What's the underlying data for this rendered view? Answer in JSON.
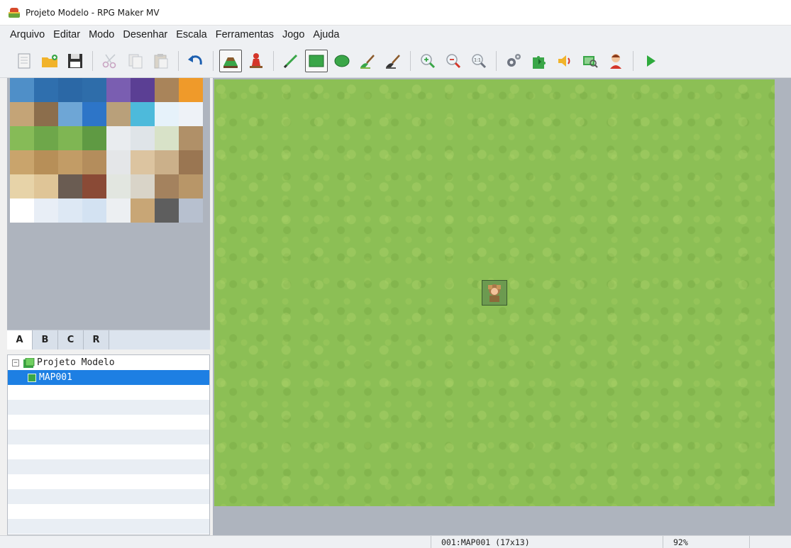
{
  "window": {
    "title": "Projeto Modelo - RPG Maker MV"
  },
  "menu": [
    "Arquivo",
    "Editar",
    "Modo",
    "Desenhar",
    "Escala",
    "Ferramentas",
    "Jogo",
    "Ajuda"
  ],
  "toolbar": {
    "groups": [
      [
        "new-project-icon",
        "open-project-icon",
        "save-project-icon"
      ],
      [
        "cut-icon",
        "copy-icon",
        "paste-icon"
      ],
      [
        "undo-icon"
      ],
      [
        "map-mode-icon",
        "event-mode-icon"
      ],
      [
        "pencil-icon",
        "rectangle-icon",
        "ellipse-icon",
        "fill-icon",
        "shadow-pen-icon"
      ],
      [
        "zoom-in-icon",
        "zoom-out-icon",
        "zoom-actual-icon"
      ],
      [
        "database-icon",
        "plugin-manager-icon",
        "sound-test-icon",
        "event-searcher-icon",
        "character-generator-icon"
      ],
      [
        "playtest-icon"
      ]
    ],
    "active": [
      "map-mode-icon",
      "rectangle-icon"
    ]
  },
  "tileset_tabs": [
    "A",
    "B",
    "C",
    "R"
  ],
  "active_tab": "A",
  "map_tree": {
    "project": "Projeto Modelo",
    "maps": [
      {
        "name": "MAP001",
        "selected": true
      }
    ]
  },
  "status": {
    "left": "",
    "map_info": "001:MAP001 (17x13)",
    "zoom": "92%"
  },
  "colors": {
    "grass": "#8cbf55",
    "panel_bg": "#aeb4be",
    "selection": "#1d7fe3",
    "menu_bg": "#eef0f3"
  }
}
